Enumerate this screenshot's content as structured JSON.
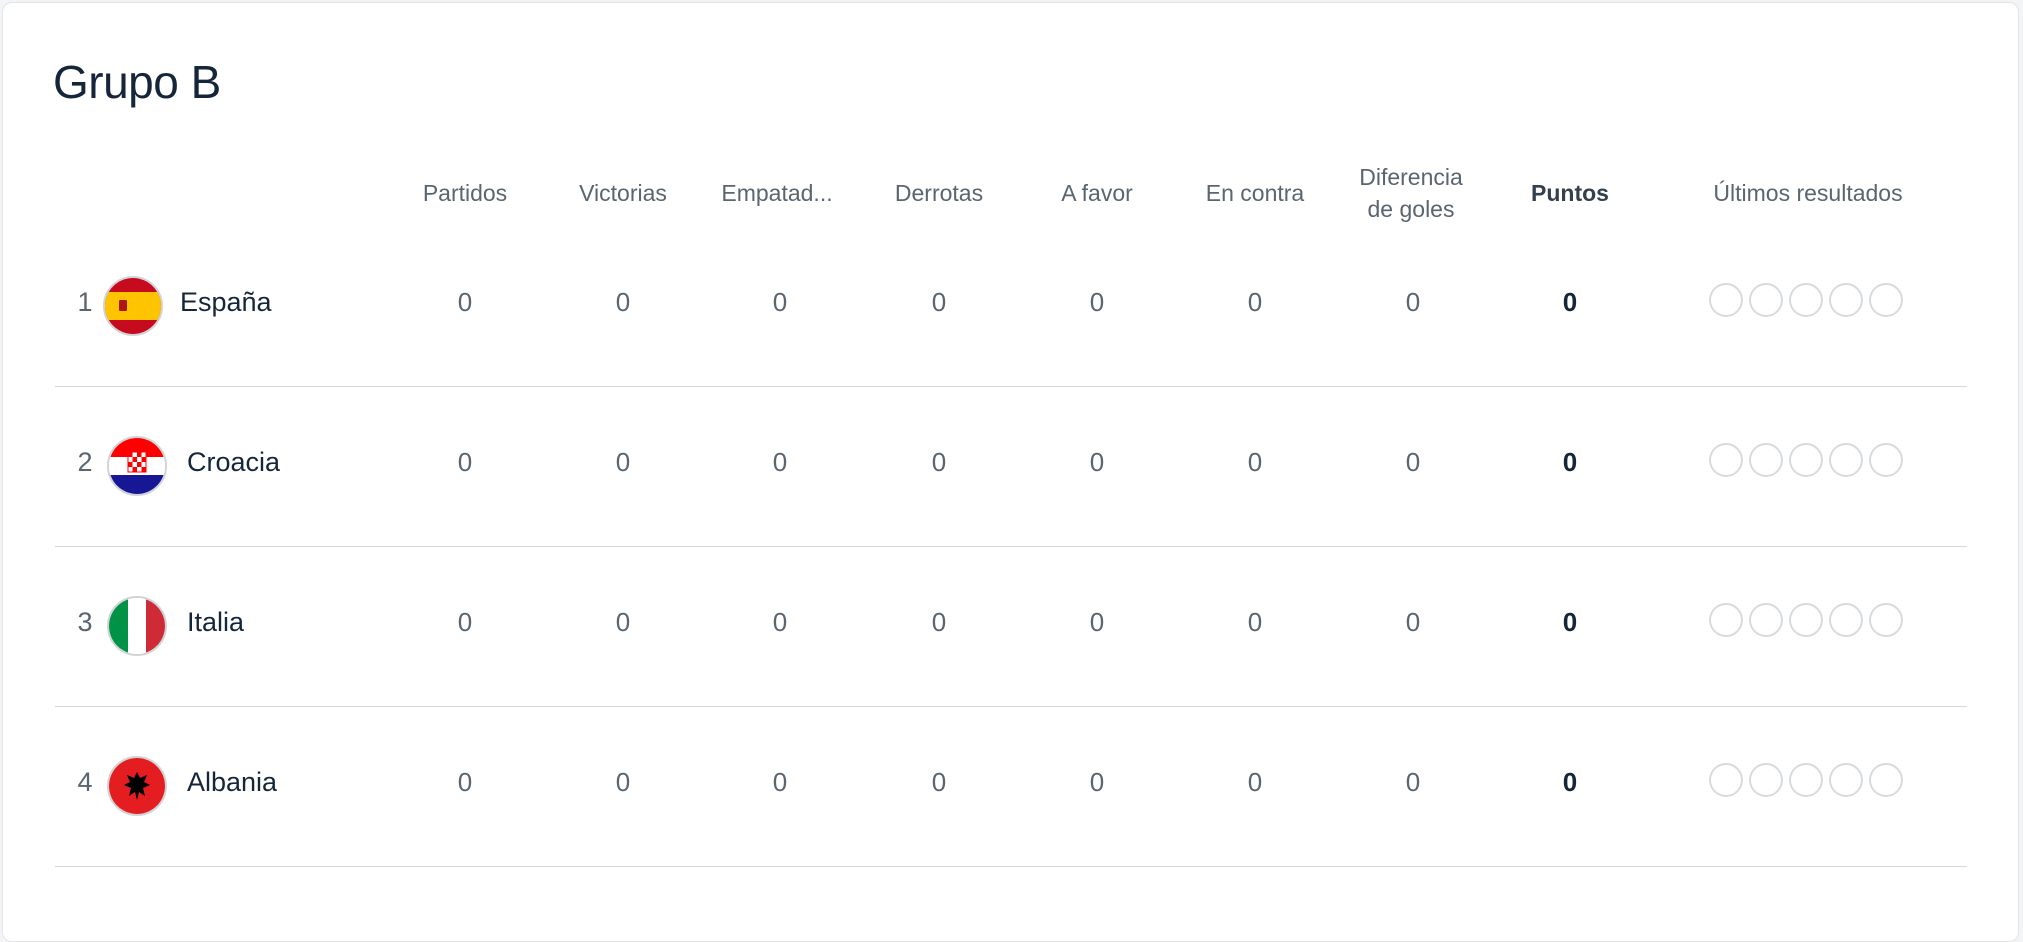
{
  "group": {
    "title": "Grupo B"
  },
  "columns": {
    "played": "Partidos",
    "won": "Victorias",
    "drawn": "Empatad...",
    "lost": "Derrotas",
    "goals_for": "A favor",
    "goals_against": "En contra",
    "goal_diff_line1": "Diferencia",
    "goal_diff_line2": "de goles",
    "points": "Puntos",
    "form": "Últimos resultados"
  },
  "teams": [
    {
      "rank": "1",
      "name": "España",
      "flag_icon": "spain-flag-icon",
      "played": "0",
      "won": "0",
      "drawn": "0",
      "lost": "0",
      "goals_for": "0",
      "goals_against": "0",
      "goal_diff": "0",
      "points": "0",
      "form": [
        "",
        "",
        "",
        "",
        ""
      ]
    },
    {
      "rank": "2",
      "name": "Croacia",
      "flag_icon": "croatia-flag-icon",
      "played": "0",
      "won": "0",
      "drawn": "0",
      "lost": "0",
      "goals_for": "0",
      "goals_against": "0",
      "goal_diff": "0",
      "points": "0",
      "form": [
        "",
        "",
        "",
        "",
        ""
      ]
    },
    {
      "rank": "3",
      "name": "Italia",
      "flag_icon": "italy-flag-icon",
      "played": "0",
      "won": "0",
      "drawn": "0",
      "lost": "0",
      "goals_for": "0",
      "goals_against": "0",
      "goal_diff": "0",
      "points": "0",
      "form": [
        "",
        "",
        "",
        "",
        ""
      ]
    },
    {
      "rank": "4",
      "name": "Albania",
      "flag_icon": "albania-flag-icon",
      "played": "0",
      "won": "0",
      "drawn": "0",
      "lost": "0",
      "goals_for": "0",
      "goals_against": "0",
      "goal_diff": "0",
      "points": "0",
      "form": [
        "",
        "",
        "",
        "",
        ""
      ]
    }
  ],
  "colors": {
    "title": "#15263a",
    "header_text": "#5a6570",
    "divider": "#d6d9dc"
  }
}
